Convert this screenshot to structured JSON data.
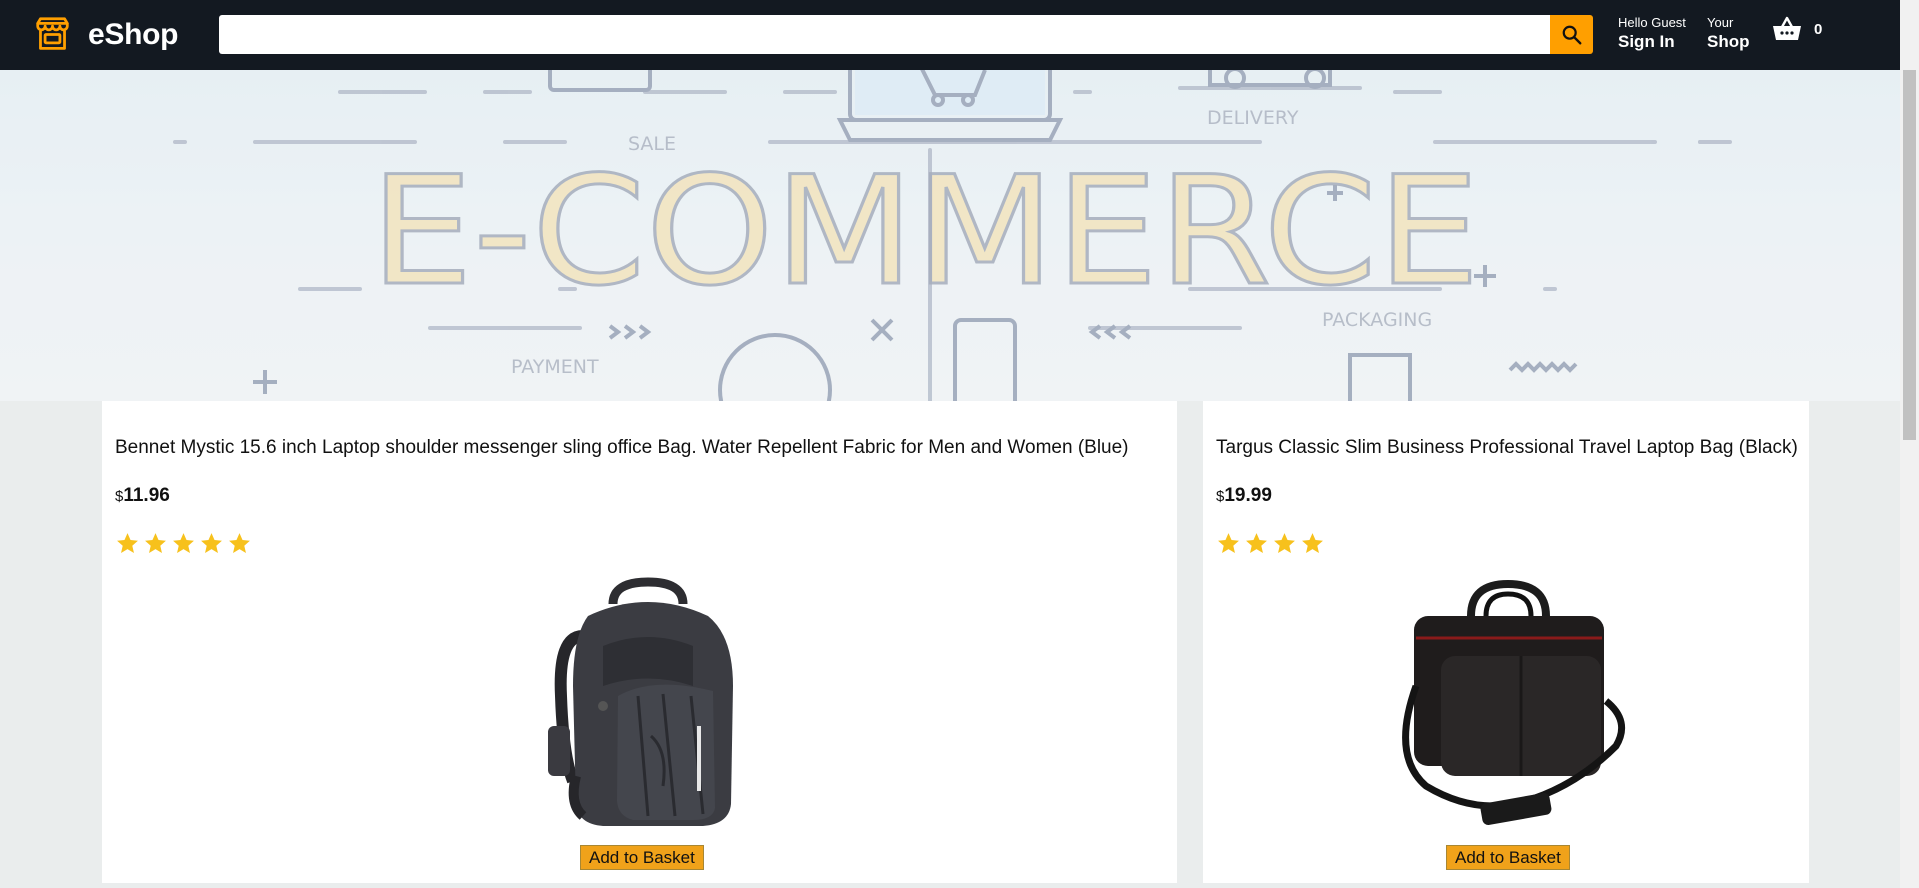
{
  "header": {
    "logo_text": "eShop",
    "search": {
      "value": "",
      "placeholder": ""
    },
    "signin": {
      "line1": "Hello Guest",
      "line2": "Sign In"
    },
    "shop": {
      "line1": "Your",
      "line2": "Shop"
    },
    "basket_count": "0",
    "icons": {
      "logo": "storefront-icon",
      "search": "search-icon",
      "basket": "basket-icon"
    }
  },
  "hero": {
    "banner_word": "E-COMMERCE",
    "labels": {
      "sale": "SALE",
      "delivery": "DELIVERY",
      "packaging": "PACKAGING",
      "payment": "PAYMENT"
    }
  },
  "products": [
    {
      "title": "Bennet Mystic 15.6 inch Laptop shoulder messenger sling office Bag. Water Repellent Fabric for Men and Women (Blue)",
      "currency": "$",
      "price": "11.96",
      "rating": 5,
      "image": "backpack-image",
      "button": "Add to Basket"
    },
    {
      "title": "Targus Classic Slim Business Professional Travel Laptop Bag (Black)",
      "currency": "$",
      "price": "19.99",
      "rating": 4,
      "image": "laptop-bag-image",
      "button": "Add to Basket"
    }
  ],
  "colors": {
    "header_bg": "#131921",
    "accent": "#ff9f00",
    "star": "#f7c11c",
    "button": "#f0a21a",
    "page_bg": "#eaeded"
  }
}
